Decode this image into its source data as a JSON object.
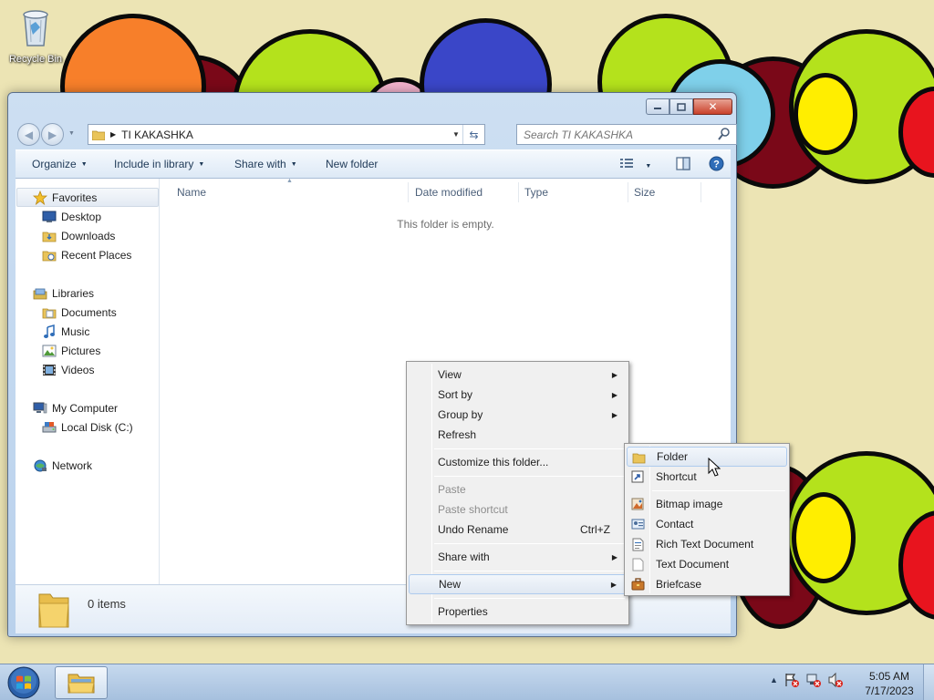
{
  "desktop": {
    "recycle_bin_label": "Recycle Bin"
  },
  "window": {
    "address": {
      "breadcrumb_folder": "TI KAKASHKA"
    },
    "search": {
      "placeholder": "Search TI KAKASHKA"
    },
    "toolbar": {
      "organize": "Organize",
      "include_in_library": "Include in library",
      "share_with": "Share with",
      "new_folder": "New folder"
    },
    "nav": {
      "favorites": "Favorites",
      "desktop": "Desktop",
      "downloads": "Downloads",
      "recent_places": "Recent Places",
      "libraries": "Libraries",
      "documents": "Documents",
      "music": "Music",
      "pictures": "Pictures",
      "videos": "Videos",
      "my_computer": "My Computer",
      "local_disk": "Local Disk (C:)",
      "network": "Network"
    },
    "columns": {
      "name": "Name",
      "date_modified": "Date modified",
      "type": "Type",
      "size": "Size"
    },
    "empty_message": "This folder is empty.",
    "details": {
      "item_count": "0 items"
    }
  },
  "context_menu": {
    "view": "View",
    "sort_by": "Sort by",
    "group_by": "Group by",
    "refresh": "Refresh",
    "customize": "Customize this folder...",
    "paste": "Paste",
    "paste_shortcut": "Paste shortcut",
    "undo_rename": "Undo Rename",
    "undo_shortcut": "Ctrl+Z",
    "share_with": "Share with",
    "new": "New",
    "properties": "Properties"
  },
  "new_submenu": {
    "folder": "Folder",
    "shortcut": "Shortcut",
    "bitmap_image": "Bitmap image",
    "contact": "Contact",
    "rich_text_document": "Rich Text Document",
    "text_document": "Text Document",
    "briefcase": "Briefcase"
  },
  "taskbar": {
    "time": "5:05 AM",
    "date": "7/17/2023"
  },
  "colors": {
    "wallpaper": "#ece4b4",
    "orange": "#f77f2a",
    "green": "#b4e21c",
    "blue": "#3a46c8",
    "maroon": "#7a0818",
    "yellow": "#ffee00",
    "light_blue": "#7fd0ea",
    "pink": "#f2b2cc",
    "red": "#e8141e"
  }
}
